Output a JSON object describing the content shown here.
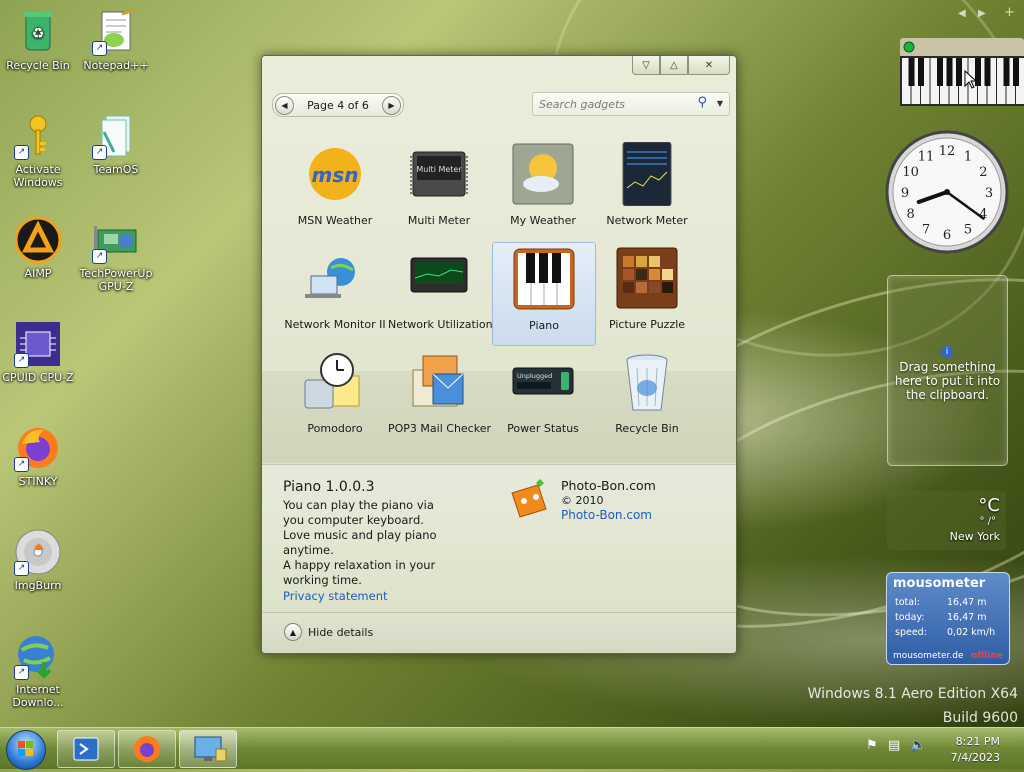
{
  "desktop": {
    "icons": [
      {
        "label": "Recycle Bin"
      },
      {
        "label": "Notepad++"
      },
      {
        "label": "Activate Windows"
      },
      {
        "label": "TeamOS"
      },
      {
        "label": "AIMP"
      },
      {
        "label": "TechPowerUp GPU-Z"
      },
      {
        "label": "CPUID CPU-Z"
      },
      {
        "label": "STINKY"
      },
      {
        "label": "ImgBurn"
      },
      {
        "label": "Internet Downlo..."
      }
    ]
  },
  "gallery": {
    "page_text": "Page 4 of 6",
    "search_placeholder": "Search gadgets",
    "gadgets": [
      {
        "name": "MSN Weather"
      },
      {
        "name": "Multi Meter"
      },
      {
        "name": "My Weather"
      },
      {
        "name": "Network Meter"
      },
      {
        "name": "Network Monitor II"
      },
      {
        "name": "Network Utilization"
      },
      {
        "name": "Piano"
      },
      {
        "name": "Picture Puzzle"
      },
      {
        "name": "Pomodoro"
      },
      {
        "name": "POP3 Mail Checker"
      },
      {
        "name": "Power Status"
      },
      {
        "name": "Recycle Bin"
      }
    ],
    "details": {
      "title": "Piano 1.0.0.3",
      "lines": [
        "You can play the piano via you computer keyboard.",
        "Love music and play piano anytime.",
        "A happy relaxation in your working time."
      ],
      "privacy": "Privacy statement",
      "author": "Photo-Bon.com",
      "year": "© 2010",
      "link": "Photo-Bon.com"
    },
    "hide_details": "Hide details",
    "icons": {
      "msn_logo": "msn",
      "multimeter_text": "Multi Meter",
      "power_status_text": "Unplugged"
    }
  },
  "sidebar": {
    "clipboard_text": "Drag something here to put it into the clipboard.",
    "weather": {
      "unit": "°C",
      "temp": "° /°",
      "city": "New York"
    },
    "clock": {
      "numbers": [
        "12",
        "1",
        "2",
        "3",
        "4",
        "5",
        "6",
        "7",
        "8",
        "9",
        "10",
        "11"
      ],
      "hour": 8,
      "minute": 21
    },
    "mousometer": {
      "title": "mousometer",
      "total_label": "total:",
      "total": "16,47 m",
      "today_label": "today:",
      "today": "16,47 m",
      "speed_label": "speed:",
      "speed": "0,02 km/h",
      "site": "mousometer.de",
      "status": "offline"
    }
  },
  "watermark": {
    "edition": "Windows 8.1 Aero Edition X64",
    "build": "Build 9600"
  },
  "taskbar": {
    "time": "8:21 PM",
    "date": "7/4/2023"
  },
  "colors": {
    "link": "#1d5fb8",
    "accent": "#6f8838",
    "offline": "#ff3b3b"
  }
}
